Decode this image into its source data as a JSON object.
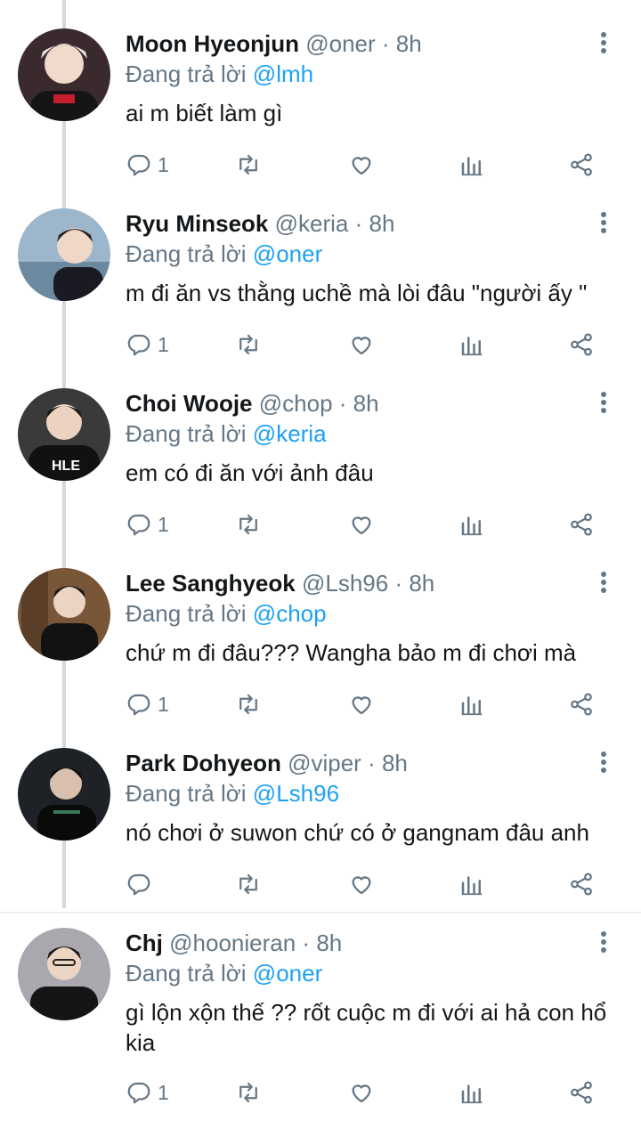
{
  "reply_prefix": "Đang trả lời",
  "icons": [
    "reply-icon",
    "retweet-icon",
    "like-icon",
    "analytics-icon",
    "share-icon",
    "more-icon"
  ],
  "colors": {
    "mention": "#1da1f2",
    "secondary": "#657786",
    "text": "#14171a"
  },
  "tweets": [
    {
      "name": "Moon Hyeonjun",
      "handle": "@oner",
      "dot": "·",
      "time": "8h",
      "reply_to": "@lmh",
      "text": "ai m biết làm gì",
      "reply_count": "1",
      "avatar_bg": "#3a2a2e"
    },
    {
      "name": "Ryu Minseok",
      "handle": "@keria",
      "dot": "·",
      "time": "8h",
      "reply_to": "@oner",
      "text": "m đi ăn vs thằng uchề mà lòi đâu \"người ấy \"",
      "reply_count": "1",
      "avatar_bg": "#8fa9c0"
    },
    {
      "name": "Choi Wooje",
      "handle": "@chop",
      "dot": "·",
      "time": "8h",
      "reply_to": "@keria",
      "text": "em có đi ăn với ảnh đâu",
      "reply_count": "1",
      "avatar_bg": "#2a2a2a"
    },
    {
      "name": "Lee Sanghyeok",
      "handle": "@Lsh96",
      "dot": "·",
      "time": "8h",
      "reply_to": "@chop",
      "text": "chứ m đi đâu??? Wangha bảo m đi chơi mà",
      "reply_count": "1",
      "avatar_bg": "#6b4a32"
    },
    {
      "name": "Park Dohyeon",
      "handle": "@viper",
      "dot": "·",
      "time": "8h",
      "reply_to": "@Lsh96",
      "text": "nó chơi ở suwon chứ có ở gangnam đâu anh",
      "reply_count": "",
      "avatar_bg": "#1e2226"
    },
    {
      "name": "Chj",
      "handle": "@hoonieran",
      "dot": "·",
      "time": "8h",
      "reply_to": "@oner",
      "text": "gì lộn xộn thế ?? rốt cuộc m đi với ai hả con hổ kia",
      "reply_count": "1",
      "avatar_bg": "#9a9aa0"
    }
  ]
}
